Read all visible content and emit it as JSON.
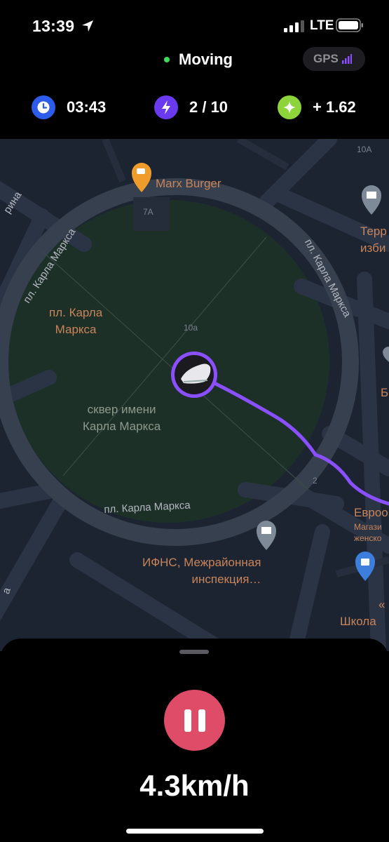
{
  "status_bar": {
    "time": "13:39",
    "network": "LTE"
  },
  "header": {
    "status_label": "Moving",
    "gps_label": "GPS"
  },
  "stats": [
    {
      "icon": "clock-icon",
      "value": "03:43",
      "color": "#2d5bea"
    },
    {
      "icon": "lightning-icon",
      "value": "2 / 10",
      "color": "#6a3af0"
    },
    {
      "icon": "sparkle-icon",
      "value": "+ 1.62",
      "color": "#8dd43a"
    }
  ],
  "map": {
    "pois": [
      {
        "name": "Marx Burger",
        "icon": "cafe-pin-icon"
      },
      {
        "name": "пл. Карла\nМаркса"
      },
      {
        "name": "сквер имени\nКарла Маркса"
      },
      {
        "name": "ИФНС, Межрайонная\nинспекция…",
        "icon": "government-pin-icon"
      },
      {
        "name": "Терр\nизби",
        "icon": "government-pin-icon"
      },
      {
        "name": "Евроо"
      },
      {
        "name": "Магази\nженско",
        "icon": "shopping-pin-icon"
      },
      {
        "name": "«"
      },
      {
        "name": "Школа"
      },
      {
        "name": "Б"
      }
    ],
    "streets": [
      "пл. Карла Маркса",
      "пл. Карла Маркса",
      "пл. Карла Маркса",
      "рина",
      "а"
    ],
    "house_numbers": [
      "7А",
      "10а",
      "10А",
      "2"
    ]
  },
  "bottom": {
    "speed": "4.3km/h"
  }
}
